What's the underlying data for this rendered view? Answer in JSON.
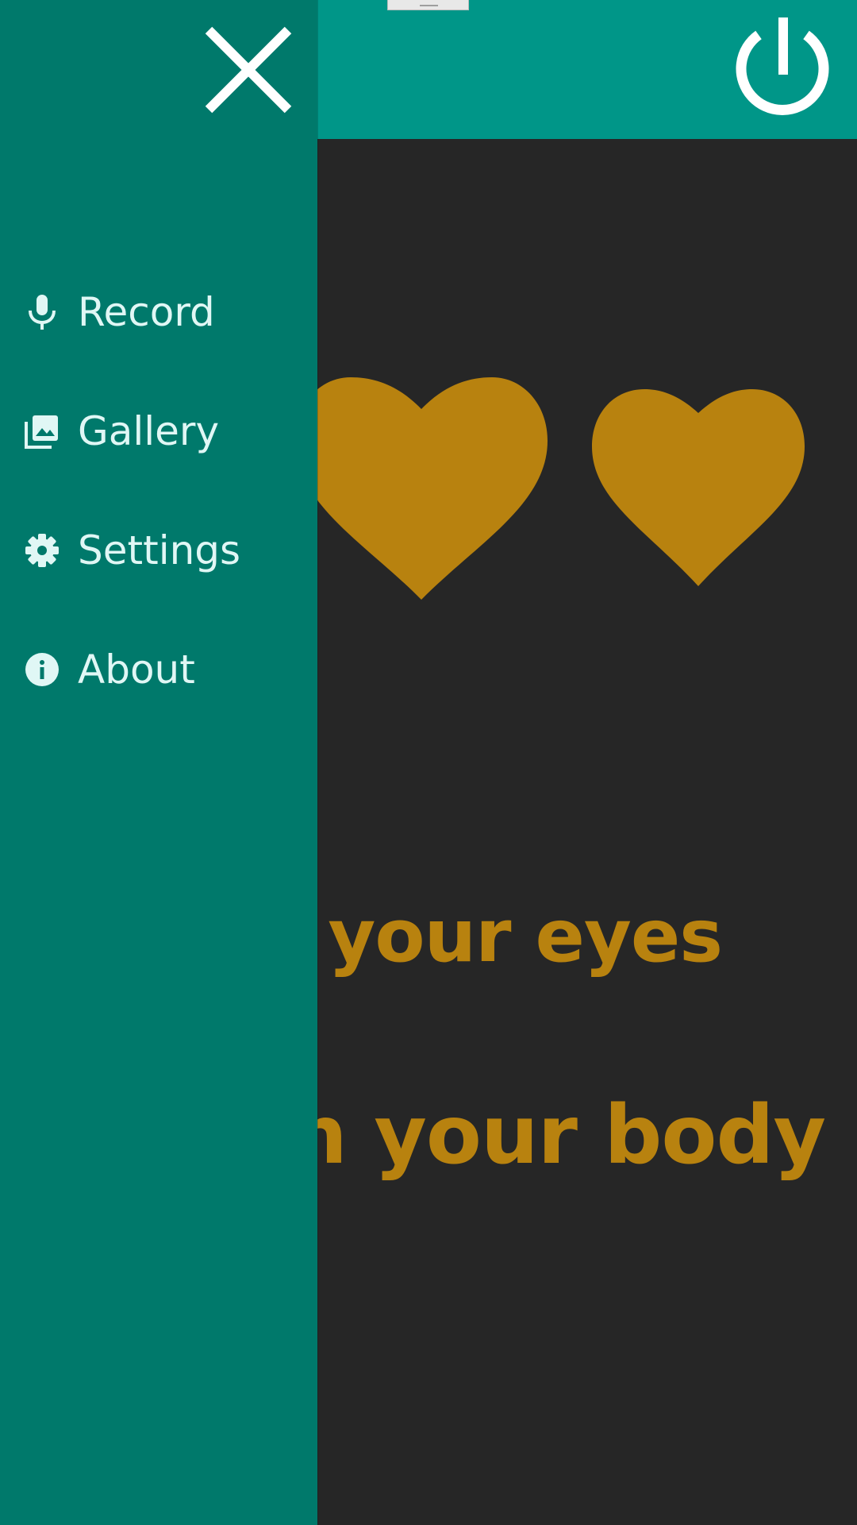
{
  "colors": {
    "app_bar": "#009688",
    "drawer": "#00796b",
    "content_bg": "#262626",
    "accent": "#b8820f",
    "drawer_text": "#e0f7f5"
  },
  "app_bar": {
    "power_icon": "power-icon"
  },
  "drawer": {
    "close_icon": "close-icon",
    "items": [
      {
        "label": "Record",
        "icon": "microphone-icon"
      },
      {
        "label": "Gallery",
        "icon": "photo-library-icon"
      },
      {
        "label": "Settings",
        "icon": "gear-icon"
      },
      {
        "label": "About",
        "icon": "info-icon"
      }
    ]
  },
  "content": {
    "hearts": [
      "heart-icon",
      "heart-icon"
    ],
    "line_1": "e your eyes",
    "line_2": "with your body"
  }
}
